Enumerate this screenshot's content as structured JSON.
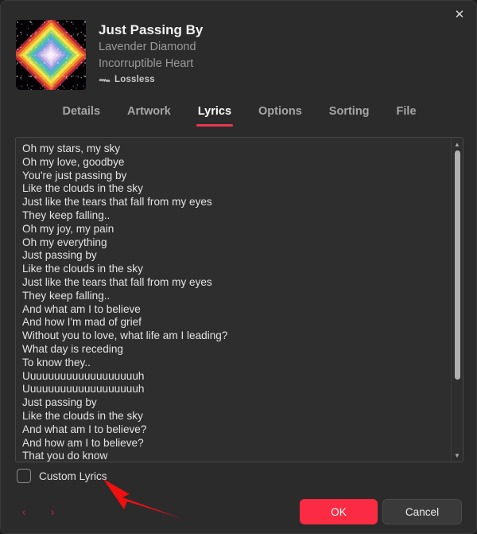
{
  "window": {
    "close_label": "✕"
  },
  "track": {
    "title": "Just Passing By",
    "artist": "Lavender Diamond",
    "album": "Incorruptible Heart",
    "quality_label": "Lossless",
    "quality_icon": "lossless-waveform-icon",
    "artwork_alt": "album-artwork-diamond"
  },
  "tabs": [
    {
      "label": "Details",
      "active": false
    },
    {
      "label": "Artwork",
      "active": false
    },
    {
      "label": "Lyrics",
      "active": true
    },
    {
      "label": "Options",
      "active": false
    },
    {
      "label": "Sorting",
      "active": false
    },
    {
      "label": "File",
      "active": false
    }
  ],
  "lyrics": {
    "lines": [
      "Oh my stars, my sky",
      "Oh my love, goodbye",
      "You're just passing by",
      "Like the clouds in the sky",
      "Just like the tears that fall from my eyes",
      "They keep falling..",
      "Oh my joy, my pain",
      "Oh my everything",
      "Just passing by",
      "Like the clouds in the sky",
      "Just like the tears that fall from my eyes",
      "They keep falling..",
      "And what am I to believe",
      "And how I'm mad of grief",
      "Without you to love, what life am I leading?",
      "What day is receding",
      "To know they..",
      "Uuuuuuuuuuuuuuuuuuuh",
      "Uuuuuuuuuuuuuuuuuuuh",
      "Just passing by",
      "Like the clouds in the sky",
      "And what am I to believe?",
      "And how am I to believe?",
      "That you do know"
    ],
    "scrollbar": {
      "up_arrow": "▲",
      "down_arrow": "▼",
      "thumb_position_percent": 0,
      "thumb_size_percent": 75
    }
  },
  "custom_lyrics": {
    "label": "Custom Lyrics",
    "checked": false
  },
  "footer": {
    "prev_label": "‹",
    "next_label": "›",
    "ok_label": "OK",
    "cancel_label": "Cancel"
  },
  "colors": {
    "accent": "#fa2b42",
    "tab_underline": "#e8384f",
    "dialog_bg": "#2b2b2b",
    "field_bg": "#2e2e2e",
    "annotation_arrow": "#f01010"
  }
}
